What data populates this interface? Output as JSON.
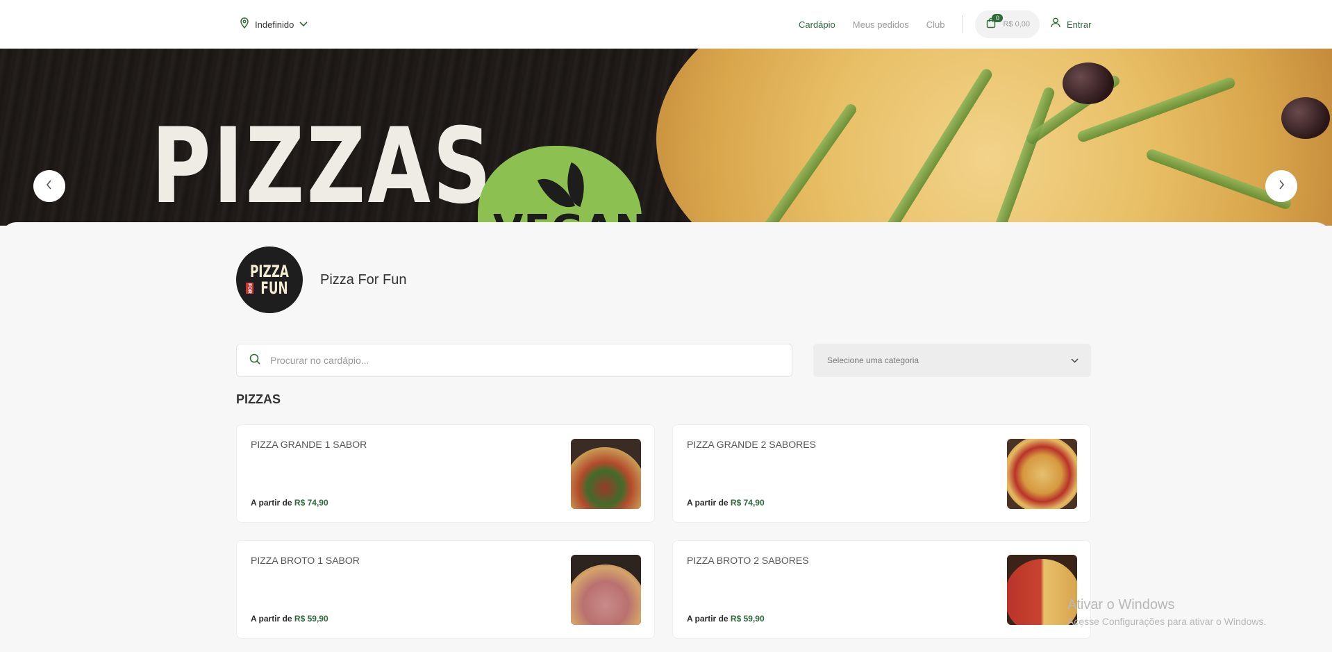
{
  "header": {
    "location_label": "Indefinido",
    "nav": [
      {
        "label": "Cardápio",
        "active": true
      },
      {
        "label": "Meus pedidos",
        "active": false
      },
      {
        "label": "Club",
        "active": false
      }
    ],
    "cart_count": "0",
    "cart_total": "R$ 0,00",
    "login_label": "Entrar"
  },
  "banner": {
    "title": "PIZZAS",
    "badge": "VEGAN"
  },
  "store": {
    "logo_line1": "PIZZA",
    "logo_for": "FOR",
    "logo_line2": "FUN",
    "name": "Pizza For Fun"
  },
  "search": {
    "placeholder": "Procurar no cardápio..."
  },
  "category_select": {
    "selected": "Selecione uma categoria"
  },
  "section": {
    "title": "PIZZAS",
    "price_prefix": "A partir de",
    "items": [
      {
        "name": "PIZZA GRANDE 1 SABOR",
        "price": "R$ 74,90"
      },
      {
        "name": "PIZZA GRANDE 2 SABORES",
        "price": "R$ 74,90"
      },
      {
        "name": "PIZZA BROTO 1 SABOR",
        "price": "R$ 59,90"
      },
      {
        "name": "PIZZA BROTO 2 SABORES",
        "price": "R$ 59,90"
      }
    ]
  },
  "watermark": {
    "line1": "Ativar o Windows",
    "line2": "Acesse Configurações para ativar o Windows."
  },
  "colors": {
    "accent": "#2e6b3a",
    "vegan_green": "#8cc152"
  }
}
